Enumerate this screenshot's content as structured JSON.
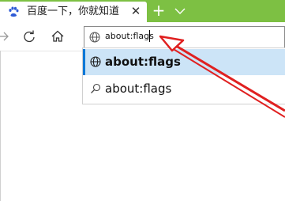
{
  "tab": {
    "title": "百度一下，你就知道",
    "favicon": "baidu-paw-icon",
    "close_glyph": "✕"
  },
  "tabbar": {
    "new_tab_glyph": "+",
    "tab_list_icon": "chevron-down-icon",
    "background_color": "#7dc043"
  },
  "nav": {
    "forward_icon": "forward-arrow-icon",
    "refresh_icon": "refresh-icon",
    "home_icon": "home-icon"
  },
  "address_bar": {
    "value": "about:flags",
    "icon": "globe-icon"
  },
  "suggestions": [
    {
      "label": "about:flags",
      "icon": "globe-icon",
      "selected": true
    },
    {
      "label": "about:flags",
      "icon": "search-icon",
      "selected": false
    }
  ],
  "colors": {
    "selection_bg": "#cce4f7",
    "selection_accent": "#0078d7",
    "annotation_arrow": "#e02020"
  }
}
